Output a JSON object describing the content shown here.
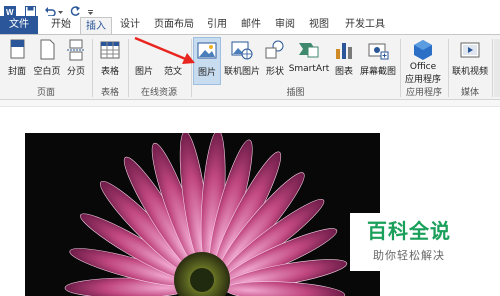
{
  "quick_access": {
    "icons": [
      "word-logo-icon",
      "save-icon",
      "undo-icon",
      "undo-dropdown-icon",
      "redo-icon",
      "customize-icon"
    ]
  },
  "tabs": [
    {
      "label": "文件"
    },
    {
      "label": "开始"
    },
    {
      "label": "插入"
    },
    {
      "label": "设计"
    },
    {
      "label": "页面布局"
    },
    {
      "label": "引用"
    },
    {
      "label": "邮件"
    },
    {
      "label": "审阅"
    },
    {
      "label": "视图"
    },
    {
      "label": "开发工具"
    }
  ],
  "active_tab": "插入",
  "ribbon": {
    "buttons": [
      {
        "label": "封面",
        "icon": "cover-page-icon"
      },
      {
        "label": "空白页",
        "icon": "blank-page-icon"
      },
      {
        "label": "分页",
        "icon": "page-break-icon"
      },
      {
        "label": "表格",
        "icon": "table-icon"
      },
      {
        "label": "图片",
        "icon": "online-picture-icon"
      },
      {
        "label": "范文",
        "icon": "template-icon"
      },
      {
        "label": "图片",
        "icon": "picture-icon"
      },
      {
        "label": "联机图片",
        "icon": "online-pictures-icon"
      },
      {
        "label": "形状",
        "icon": "shapes-icon"
      },
      {
        "label": "SmartArt",
        "icon": "smartart-icon"
      },
      {
        "label": "图表",
        "icon": "chart-icon"
      },
      {
        "label": "屏幕截图",
        "icon": "screenshot-icon"
      },
      {
        "label": "Office",
        "label2": "应用程序",
        "icon": "office-apps-icon"
      },
      {
        "label": "联机视频",
        "icon": "online-video-icon"
      }
    ],
    "groups": [
      "页面",
      "表格",
      "在线资源",
      "插图",
      "应用程序",
      "媒体"
    ]
  },
  "colors": {
    "file_tab": "#2b579a",
    "ribbon_bg": "#f3f3f3",
    "selected": "#c8dcf0",
    "arrow": "#e8261f",
    "watermark": "#1aa05a"
  },
  "watermark": {
    "title": "百科全说",
    "subtitle": "助你轻松解决"
  }
}
